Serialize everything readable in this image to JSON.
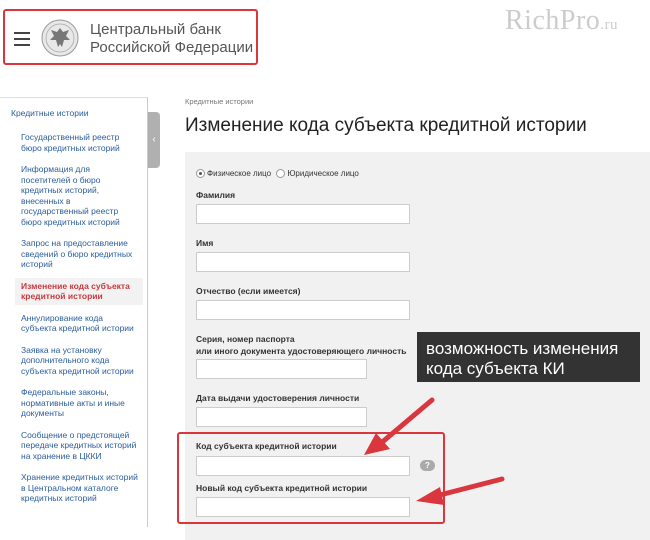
{
  "header": {
    "bank_name_line1": "Центральный банк",
    "bank_name_line2": "Российской Федерации"
  },
  "watermark": {
    "main": "RichPro",
    "suffix": ".ru"
  },
  "sidebar": {
    "title": "Кредитные истории",
    "items": [
      {
        "label": "Государственный реестр бюро кредитных историй"
      },
      {
        "label": "Информация для посетителей о бюро кредитных историй, внесенных в государственный реестр бюро кредитных историй"
      },
      {
        "label": "Запрос на предоставление сведений о бюро кредитных историй"
      },
      {
        "label": "Изменение кода субъекта кредитной истории"
      },
      {
        "label": "Аннулирование кода субъекта кредитной истории"
      },
      {
        "label": "Заявка на установку дополнительного кода субъекта кредитной истории"
      },
      {
        "label": "Федеральные законы, нормативные акты и иные документы"
      },
      {
        "label": "Сообщение о предстоящей передаче кредитных историй на хранение в ЦККИ"
      },
      {
        "label": "Хранение кредитных историй в Центральном каталоге кредитных историй"
      }
    ],
    "active_index": 3,
    "toggle_icon": "‹"
  },
  "breadcrumb": "Кредитные истории",
  "page_title": "Изменение кода субъекта кредитной истории",
  "form": {
    "radio_individual": "Физическое лицо",
    "radio_legal": "Юридическое лицо",
    "selected": "individual",
    "last_name_label": "Фамилия",
    "first_name_label": "Имя",
    "patronymic_label": "Отчество (если имеется)",
    "passport_label_line1": "Серия, номер паспорта",
    "passport_label_line2": "или иного документа удостоверяющего личность",
    "issue_date_label": "Дата выдачи удостоверения личности",
    "code_label": "Код субъекта кредитной истории",
    "new_code_label": "Новый код субъекта кредитной истории",
    "help_icon": "?"
  },
  "annotation": {
    "callout_line1": "возможность изменения",
    "callout_line2": "кода субъекта КИ",
    "accent_color": "#d9363e"
  }
}
